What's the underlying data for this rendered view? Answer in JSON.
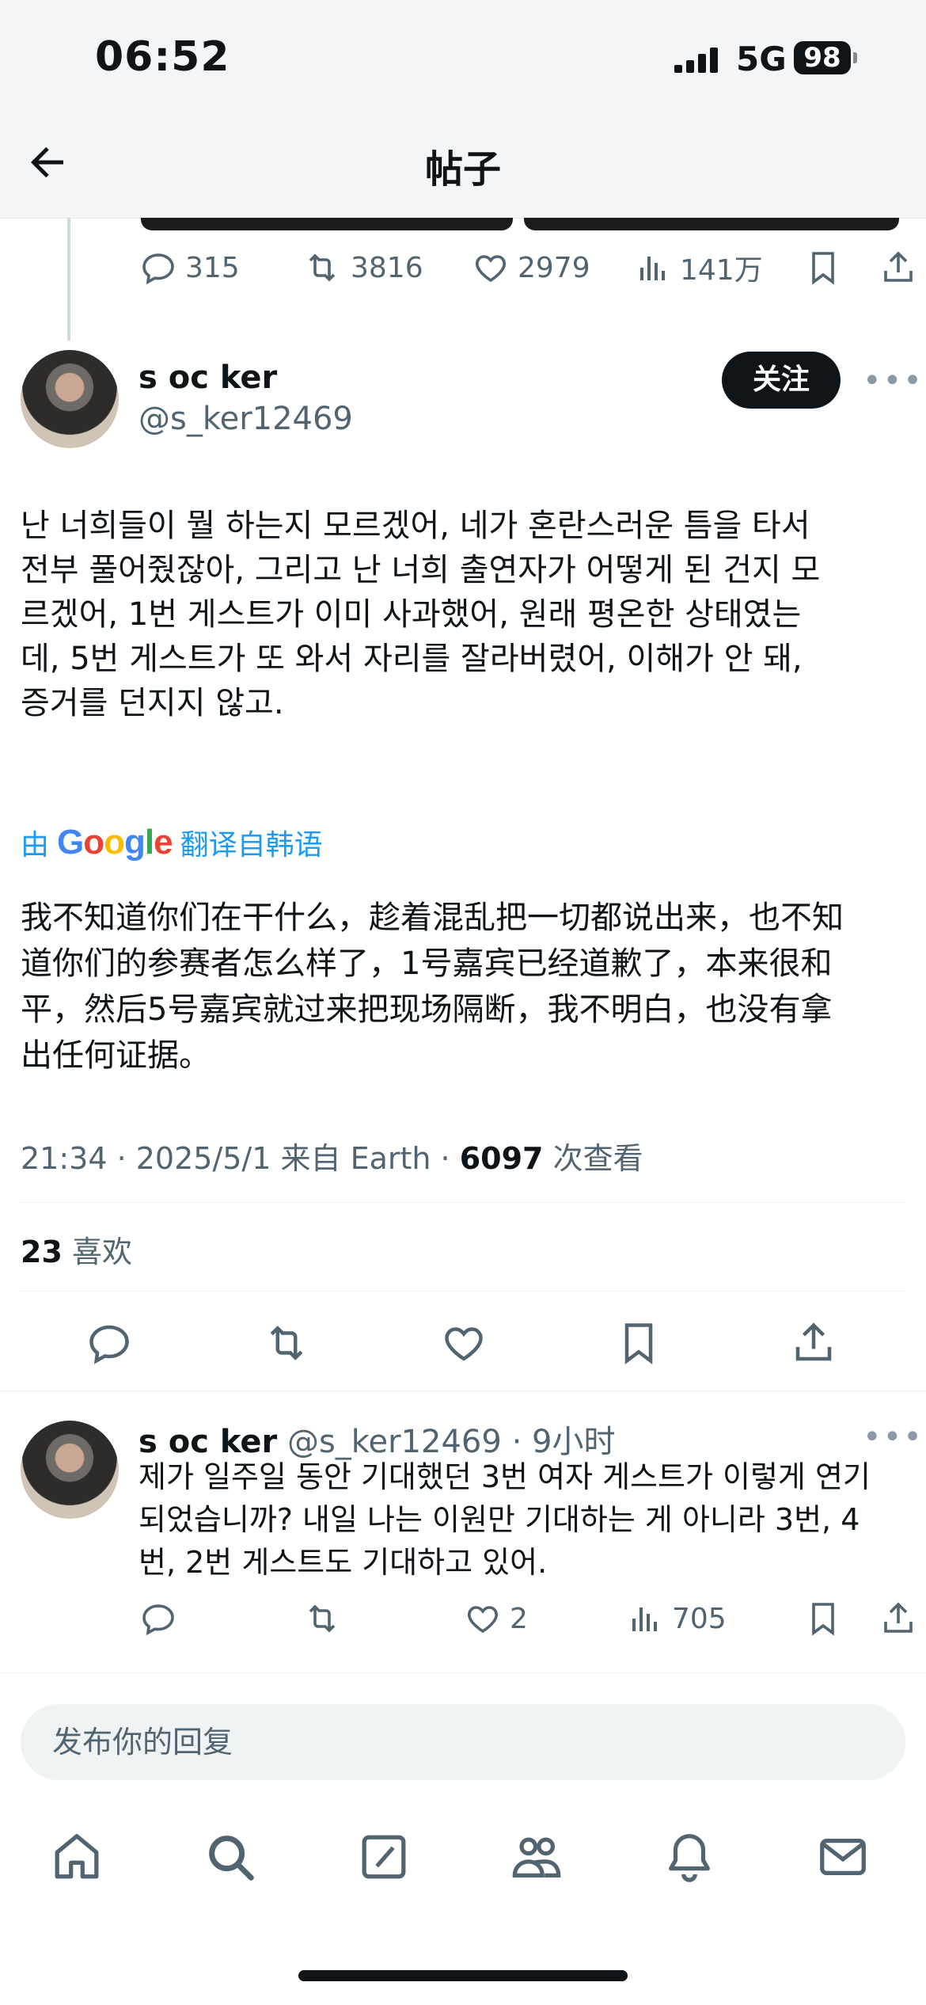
{
  "status_bar": {
    "time": "06:52",
    "network": "5G",
    "battery": "98"
  },
  "header": {
    "title": "帖子"
  },
  "prev_tweet": {
    "replies": "315",
    "retweets": "3816",
    "likes": "2979",
    "views": "141万"
  },
  "main_tweet": {
    "author_name": "s oc ker",
    "author_handle": "@s_ker12469",
    "follow_label": "关注",
    "original_text": "난 너희들이 뭘 하는지 모르겠어, 네가 혼란스러운 틈을 타서\n전부 풀어줬잖아, 그리고 난 너희 출연자가 어떻게 된 건지 모\n르겠어, 1번 게스트가 이미 사과했어, 원래 평온한 상태였는\n데, 5번 게스트가 또 와서 자리를 잘라버렸어, 이해가 안 돼,\n증거를 던지지 않고.",
    "translate_prefix": "由",
    "translate_brand": "Google",
    "translate_suffix": "翻译自韩语",
    "translated_text": "我不知道你们在干什么，趁着混乱把一切都说出来，也不知\n道你们的参赛者怎么样了，1号嘉宾已经道歉了，本来很和\n平，然后5号嘉宾就过来把现场隔断，我不明白，也没有拿\n出任何证据。",
    "meta_time": "21:34 · 2025/5/1 来自 Earth · ",
    "views_count": "6097",
    "views_label": " 次查看",
    "likes_count": "23",
    "likes_label": " 喜欢"
  },
  "reply": {
    "author_name": "s oc ker",
    "author_handle": "@s_ker12469",
    "time": "· 9小时",
    "text": "제가 일주일 동안 기대했던 3번 여자 게스트가 이렇게 연기\n되었습니까? 내일 나는 이원만 기대하는 게 아니라 3번, 4\n번, 2번 게스트도 기대하고 있어.",
    "likes": "2",
    "views": "705"
  },
  "reply_input": {
    "placeholder": "发布你的回复"
  },
  "bottom_nav": [
    "home-icon",
    "search-icon",
    "compose-icon",
    "communities-icon",
    "notifications-icon",
    "messages-icon"
  ]
}
